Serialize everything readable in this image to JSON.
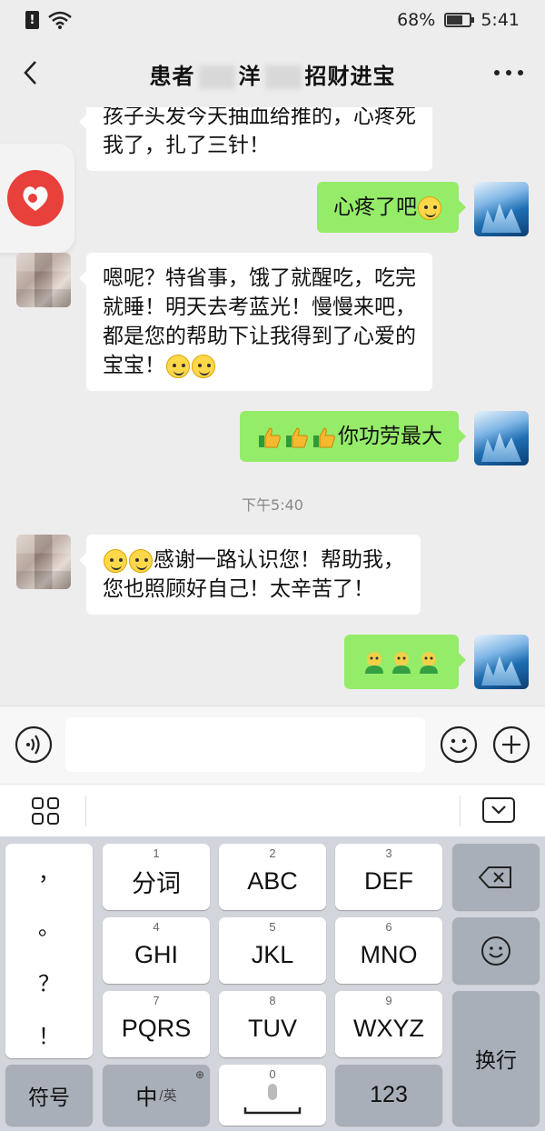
{
  "status_bar": {
    "battery": "68%",
    "battery_level": 0.68,
    "time": "5:41",
    "sim_icon": "!"
  },
  "header": {
    "title_part1": "患者",
    "title_part2": "洋",
    "title_part3": "招财进宝"
  },
  "messages": [
    {
      "side": "left",
      "text_line1": "孩子头发今天抽血给推的，心疼死",
      "text_line2": "我了，扎了三针！"
    },
    {
      "side": "right",
      "text": "心疼了吧",
      "emoji": "smile"
    },
    {
      "side": "left",
      "line1": "嗯呢？特省事，饿了就醒吃，吃完",
      "line2": "就睡！明天去考蓝光！慢慢来吧，",
      "line3": "都是您的帮助下让我得到了心爱的",
      "line4": "宝宝！"
    },
    {
      "side": "right",
      "text": "你功劳最大"
    },
    {
      "side": "left",
      "line1": "感谢一路认识您！帮助我，",
      "line2": "您也照顾好自己！太辛苦了！"
    },
    {
      "side": "right",
      "text": ""
    }
  ],
  "timestamp": "下午5:40",
  "input": {
    "placeholder": ""
  },
  "keyboard": {
    "punctuation": [
      "，",
      "。",
      "？",
      "！"
    ],
    "rows": [
      [
        {
          "num": "1",
          "label": "分词"
        },
        {
          "num": "2",
          "label": "ABC"
        },
        {
          "num": "3",
          "label": "DEF"
        }
      ],
      [
        {
          "num": "4",
          "label": "GHI"
        },
        {
          "num": "5",
          "label": "JKL"
        },
        {
          "num": "6",
          "label": "MNO"
        }
      ],
      [
        {
          "num": "7",
          "label": "PQRS"
        },
        {
          "num": "8",
          "label": "TUV"
        },
        {
          "num": "9",
          "label": "WXYZ"
        }
      ]
    ],
    "symbol_key": "符号",
    "lang_key_main": "中",
    "lang_key_sub": "/英",
    "space_num": "0",
    "num_key": "123",
    "enter_key": "换行"
  },
  "icons": {
    "back": "chevron-left-icon",
    "more": "more-dots-icon",
    "voice": "voice-icon",
    "emoji": "emoji-icon",
    "plus": "plus-icon",
    "grid": "grid-icon",
    "hide_keyboard": "keyboard-hide-icon",
    "backspace": "backspace-icon",
    "keyboard_emoji": "keyboard-emoji-icon",
    "mic": "mic-icon",
    "globe": "globe-icon"
  },
  "colors": {
    "my_bubble": "#95ec69",
    "friend_bubble": "#ffffff",
    "background": "#ededed",
    "badge": "#e8403a"
  }
}
